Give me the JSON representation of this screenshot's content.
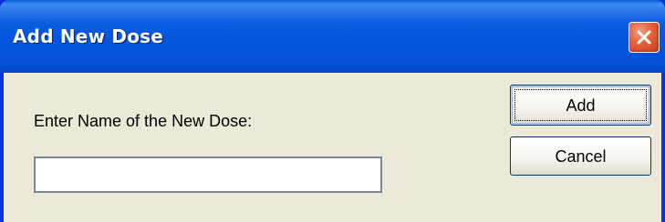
{
  "window": {
    "title": "Add New Dose",
    "close_icon": "close-icon"
  },
  "form": {
    "prompt_label": "Enter Name of the New Dose:",
    "name_value": ""
  },
  "buttons": {
    "add_label": "Add",
    "cancel_label": "Cancel"
  },
  "colors": {
    "titlebar": "#0554de",
    "client_background": "#ece9d8",
    "close_button": "#e5603a"
  }
}
